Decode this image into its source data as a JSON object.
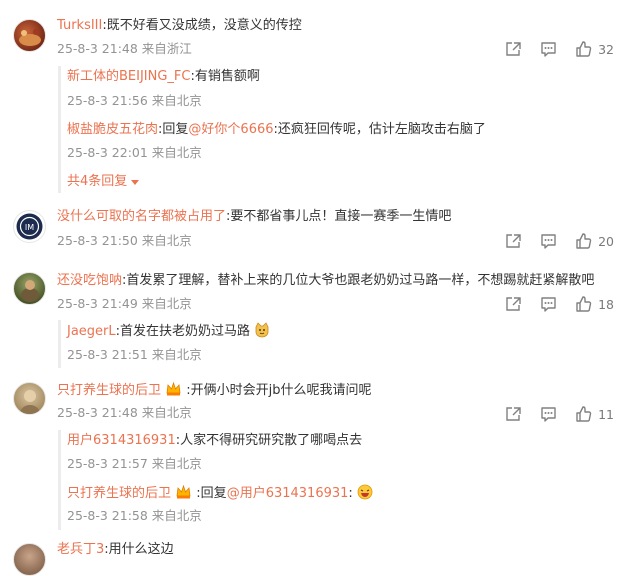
{
  "comments": [
    {
      "user": "TurksIII",
      "text": "既不好看又没成绩，没意义的传控",
      "meta": "25-8-3 21:48 来自浙江",
      "likes": "32",
      "replies": [
        {
          "user": "新工体的BEIJING_FC",
          "text": "有销售额啊",
          "meta": "25-8-3 21:56 来自北京"
        },
        {
          "user": "椒盐脆皮五花肉",
          "prefix": "回复",
          "mention": "@好你个6666",
          "text": "还疯狂回传呢，估计左脑攻击右脑了",
          "meta": "25-8-3 22:01 来自北京"
        }
      ],
      "more_label": "共4条回复"
    },
    {
      "user": "没什么可取的名字都被占用了",
      "text": "要不都省事儿点！直接一赛季一生情吧",
      "meta": "25-8-3 21:50 来自北京",
      "likes": "20"
    },
    {
      "user": "还没吃饱呐",
      "text": "首发累了理解，替补上来的几位大爷也跟老奶奶过马路一样，不想踢就赶紧解散吧",
      "meta": "25-8-3 21:49 来自北京",
      "likes": "18",
      "replies": [
        {
          "user": "JaegerL",
          "text": "首发在扶老奶奶过马路",
          "meta": "25-8-3 21:51 来自北京"
        }
      ]
    },
    {
      "user": "只打养生球的后卫",
      "text": "开俩小时会开jb什么呢我请问呢",
      "meta": "25-8-3 21:48 来自北京",
      "likes": "11",
      "replies": [
        {
          "user": "用户6314316931",
          "text": "人家不得研究研究散了哪喝点去",
          "meta": "25-8-3 21:57 来自北京"
        },
        {
          "user": "只打养生球的后卫",
          "prefix": "回复",
          "mention": "@用户6314316931",
          "text": "",
          "meta": "25-8-3 21:58 来自北京"
        }
      ]
    },
    {
      "user": "老兵丁3",
      "text": "用什么这边"
    }
  ],
  "colors": {
    "name": "#eb7350",
    "meta": "#939393",
    "text": "#333333",
    "bar": "#ececec"
  },
  "icons": [
    "share-icon",
    "comment-icon",
    "like-icon",
    "caret-down-icon",
    "crown-emoji-icon",
    "cat-emoji-icon",
    "laughing-emoji-icon"
  ]
}
